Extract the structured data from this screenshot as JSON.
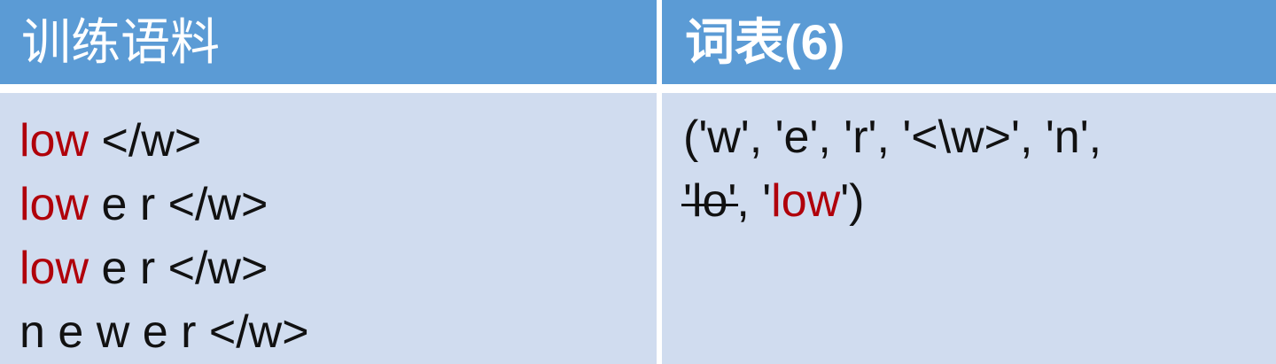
{
  "header": {
    "corpus_title": "训练语料",
    "vocab_title": "词表(6)"
  },
  "corpus": {
    "lines": [
      {
        "merged": "low",
        "rest": " </w>"
      },
      {
        "merged": "low",
        "rest": " e r </w>"
      },
      {
        "merged": "low",
        "rest": " e r </w>"
      },
      {
        "merged": "",
        "rest": "n e w e r </w>"
      }
    ]
  },
  "vocab": {
    "line1": "('w', 'e', 'r', '<\\w>', 'n',",
    "struck_token": "'lo'",
    "separator": ", '",
    "new_token": "low",
    "closing": "')"
  },
  "colors": {
    "header_bg": "#5b9bd5",
    "body_bg": "#d0dcef",
    "highlight": "#b0000a"
  }
}
